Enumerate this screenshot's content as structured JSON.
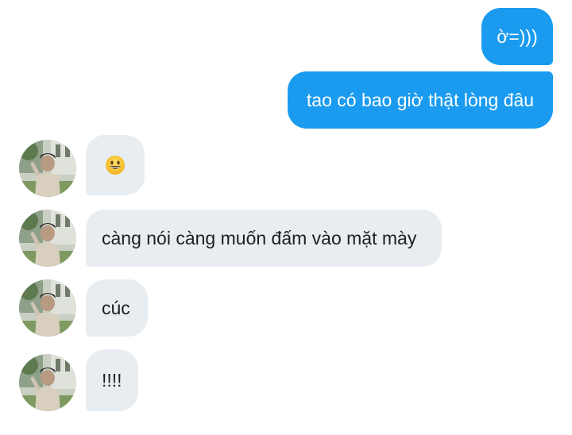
{
  "messages": {
    "sent": [
      {
        "text": "ờ=)))"
      },
      {
        "text": "tao có bao giờ thật lòng đâu"
      }
    ],
    "received": [
      {
        "text": "",
        "emoji": "grinning-face-icon"
      },
      {
        "text": "càng nói càng muốn đấm vào mặt mày"
      },
      {
        "text": "cúc"
      },
      {
        "text": "!!!!"
      }
    ]
  },
  "colors": {
    "sent_bubble": "#1a9bf0",
    "received_bubble": "#e8edf2",
    "sent_text": "#ffffff",
    "received_text": "#1b1f24"
  }
}
